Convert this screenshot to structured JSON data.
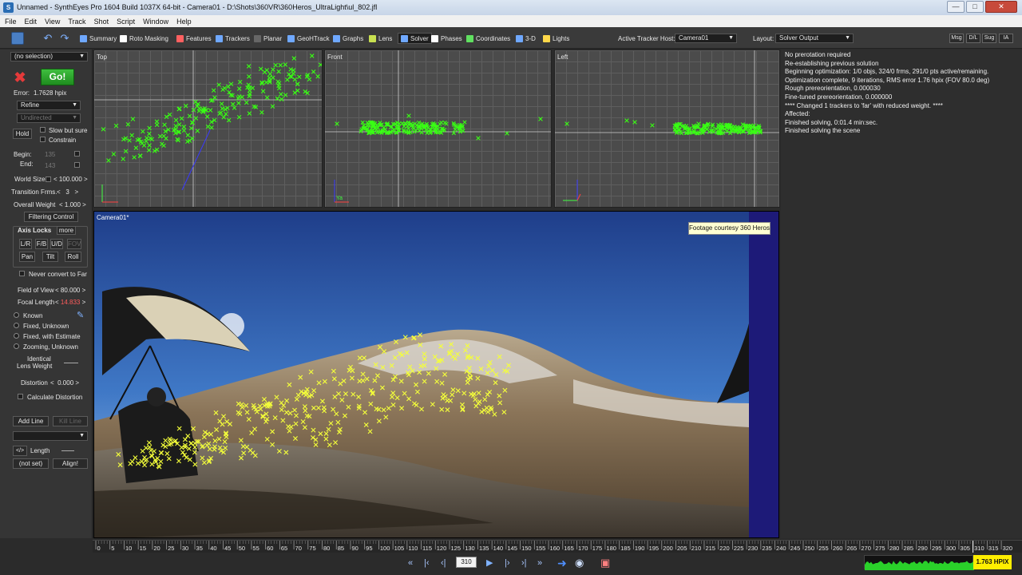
{
  "window": {
    "title": "Unnamed - SynthEyes Pro 1604 Build 1037X 64-bit - Camera01 - D:\\Shots\\360VR\\360Heros_UltraLight\\ul_802.jfl"
  },
  "menu": [
    "File",
    "Edit",
    "View",
    "Track",
    "Shot",
    "Script",
    "Window",
    "Help"
  ],
  "toolbar": {
    "tabs": [
      {
        "label": "Summary",
        "icon": "summary-icon",
        "color": "#6fa8ff"
      },
      {
        "label": "Roto Masking",
        "icon": "roto-icon",
        "color": "#ffffff"
      },
      {
        "label": "Features",
        "icon": "features-icon",
        "color": "#ff6060"
      },
      {
        "label": "Trackers",
        "icon": "trackers-icon",
        "color": "#6fa8ff"
      },
      {
        "label": "Planar",
        "icon": "planar-icon",
        "color": "#666666"
      },
      {
        "label": "GeoHTrack",
        "icon": "geohtrack-icon",
        "color": "#6fa8ff"
      },
      {
        "label": "Graphs",
        "icon": "graphs-icon",
        "color": "#6fa8ff"
      },
      {
        "label": "Lens",
        "icon": "lens-icon",
        "color": "#c8e050"
      },
      {
        "label": "Solver",
        "icon": "solver-icon",
        "color": "#6fa8ff"
      },
      {
        "label": "Phases",
        "icon": "phases-icon",
        "color": "#ffffff"
      },
      {
        "label": "Coordinates",
        "icon": "coordinates-icon",
        "color": "#60e060"
      },
      {
        "label": "3-D",
        "icon": "3d-icon",
        "color": "#6fa8ff"
      },
      {
        "label": "Lights",
        "icon": "lights-icon",
        "color": "#ffd84a"
      }
    ],
    "active_tab": "Solver",
    "active_tracker_host_label": "Active Tracker Host:",
    "active_tracker_host_value": "Camera01",
    "layout_label": "Layout:",
    "layout_value": "Solver Output",
    "right_buttons": [
      "Msg",
      "D/L",
      "Sug",
      "IA"
    ]
  },
  "solver_panel": {
    "selection": "(no selection)",
    "go_label": "Go!",
    "error_label": "Error:",
    "error_value": "1.7628 hpix",
    "mode": "Refine",
    "direction": "Undirected",
    "hold_label": "Hold",
    "slow_but_sure": "Slow but sure",
    "constrain": "Constrain",
    "begin_label": "Begin:",
    "begin_value": "135",
    "end_label": "End:",
    "end_value": "143",
    "world_size_label": "World Size",
    "world_size_value": "100.000",
    "transition_label": "Transition Frms.",
    "transition_value": "3",
    "overall_weight_label": "Overall Weight",
    "overall_weight_value": "1.000",
    "filtering_control": "Filtering Control",
    "axis_locks_label": "Axis Locks",
    "more_label": "more",
    "axis_buttons": [
      "L/R",
      "F/B",
      "U/D",
      "FOV"
    ],
    "rot_buttons": [
      "Pan",
      "Tilt",
      "Roll"
    ],
    "never_convert": "Never convert to Far",
    "fov_label": "Field of View",
    "fov_value": "80.000",
    "focal_label": "Focal Length",
    "focal_value": "14.833",
    "lens_modes": [
      "Known",
      "Fixed, Unknown",
      "Fixed, with Estimate",
      "Zooming, Unknown"
    ],
    "identical_lens_weight_1": "Identical",
    "identical_lens_weight_2": "Lens Weight",
    "distortion_label": "Distortion",
    "distortion_value": "0.000",
    "calculate_distortion": "Calculate Distortion",
    "add_line": "Add Line",
    "kill_line": "Kill Line",
    "length_label": "Length",
    "not_set": "(not set)",
    "align": "Align!"
  },
  "viewports": {
    "top": "Top",
    "front": "Front",
    "left": "Left",
    "front_axis_label": "Ya"
  },
  "camera_view": {
    "label": "Camera01*",
    "courtesy": "Footage courtesy 360 Heros"
  },
  "log": [
    "No prerotation required",
    "Re-establishing previous solution",
    "Beginning optimization: 1/0 objs, 324/0 frms, 291/0 pts active/remaining.",
    "Optimization complete, 9 iterations, RMS error 1.76 hpix (FOV 80.0 deg)",
    "Rough prereorientation, 0.000030",
    "Fine-tuned prereorientation, 0.000000",
    "**** Changed 1 trackers to 'far' with reduced weight. ****",
    "Affected:",
    "Finished solving, 0:01.4 min:sec.",
    "Finished solving the scene"
  ],
  "timeline": {
    "ticks": [
      "0",
      "5",
      "10",
      "15",
      "20",
      "25",
      "30",
      "35",
      "40",
      "45",
      "50",
      "55",
      "60",
      "65",
      "70",
      "75",
      "80",
      "85",
      "90",
      "95",
      "100",
      "105",
      "110",
      "115",
      "120",
      "125",
      "130",
      "135",
      "140",
      "145",
      "150",
      "155",
      "160",
      "165",
      "170",
      "175",
      "180",
      "185",
      "190",
      "195",
      "200",
      "205",
      "210",
      "215",
      "220",
      "225",
      "230",
      "235",
      "240",
      "245",
      "250",
      "255",
      "260",
      "265",
      "270",
      "275",
      "280",
      "285",
      "290",
      "295",
      "300",
      "305",
      "310",
      "315",
      "320"
    ],
    "current_frame": 310
  },
  "transport": {
    "frame": "310",
    "hpix": "1.763 HPIX"
  },
  "colors": {
    "tracker_green": "#39ff14",
    "tracker_yellow": "#f4ff3a",
    "go_green": "#2aa52a",
    "hpix_yellow": "#ffee00"
  }
}
